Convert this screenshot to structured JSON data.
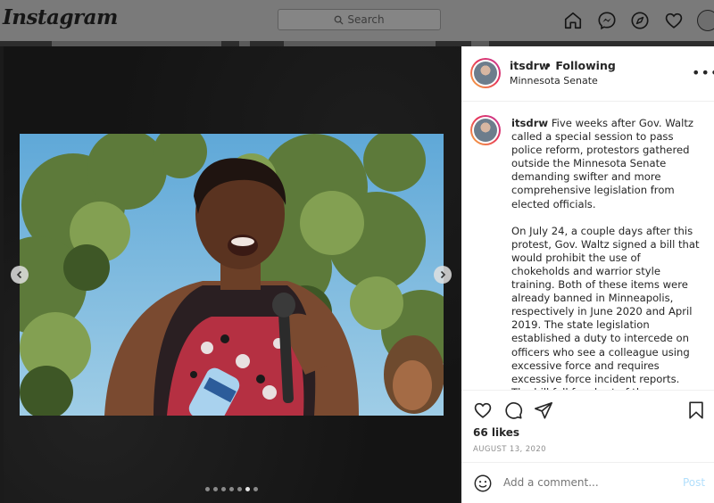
{
  "header": {
    "logo": "Instagram",
    "search_placeholder": "Search",
    "nav_icons": [
      "home-icon",
      "messenger-icon",
      "explore-icon",
      "heart-icon",
      "profile-avatar"
    ]
  },
  "post": {
    "username": "itsdrw",
    "follow_status": "• Following",
    "location": "Minnesota Senate",
    "caption_paragraph_1": "Five weeks after Gov. Waltz called a special session to pass police reform, protestors gathered outside the Minnesota Senate demanding swifter and more comprehensive legislation from elected officials.",
    "caption_paragraph_2": "On July 24, a couple days after this protest, Gov. Waltz signed a bill that would prohibit the use of chokeholds and warrior style training. Both of these items were already banned in Minneapolis, respectively in June 2020 and April 2019. The state legislation established a duty to intercede on officers who see a colleague using excessive force and requires excessive force incident reports. The bill fell far short of the transformational change demanded after the murder of George",
    "likes": "66 likes",
    "date": "AUGUST 13, 2020",
    "comment_placeholder": "Add a comment...",
    "post_button": "Post",
    "carousel_dots": 7,
    "carousel_active_dot": 6
  },
  "colors": {
    "post_button": "#b2dffc",
    "text": "#262626",
    "muted": "#8e8e8e"
  }
}
